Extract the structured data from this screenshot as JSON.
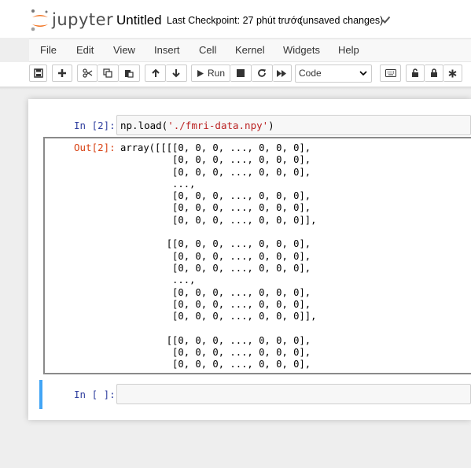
{
  "header": {
    "logo_text": "jupyter",
    "notebook_title": "Untitled",
    "checkpoint": "Last Checkpoint: 27 phút trước",
    "save_status": "(unsaved changes)",
    "saved_icon": "check-icon"
  },
  "menu": {
    "items": [
      "File",
      "Edit",
      "View",
      "Insert",
      "Cell",
      "Kernel",
      "Widgets",
      "Help"
    ]
  },
  "toolbar": {
    "run_label": "Run",
    "cell_type": "Code",
    "icons": [
      "save-icon",
      "plus-icon",
      "cut-icon",
      "copy-icon",
      "paste-icon",
      "arrow-up-icon",
      "arrow-down-icon",
      "play-icon",
      "stop-icon",
      "restart-icon",
      "fast-forward-icon",
      "keyboard-icon",
      "unlock-icon",
      "lock-icon",
      "asterisk-icon"
    ]
  },
  "cells": {
    "cell1": {
      "in_prompt": "In [2]:",
      "code_prefix": "np.load(",
      "code_string": "'./fmri-data.npy'",
      "code_suffix": ")",
      "out_prompt": "Out[2]:",
      "output": "array([[[[0, 0, 0, ..., 0, 0, 0],\n         [0, 0, 0, ..., 0, 0, 0],\n         [0, 0, 0, ..., 0, 0, 0],\n         ...,\n         [0, 0, 0, ..., 0, 0, 0],\n         [0, 0, 0, ..., 0, 0, 0],\n         [0, 0, 0, ..., 0, 0, 0]],\n\n        [[0, 0, 0, ..., 0, 0, 0],\n         [0, 0, 0, ..., 0, 0, 0],\n         [0, 0, 0, ..., 0, 0, 0],\n         ...,\n         [0, 0, 0, ..., 0, 0, 0],\n         [0, 0, 0, ..., 0, 0, 0],\n         [0, 0, 0, ..., 0, 0, 0]],\n\n        [[0, 0, 0, ..., 0, 0, 0],\n         [0, 0, 0, ..., 0, 0, 0],\n         [0, 0, 0, ..., 0, 0, 0],"
    },
    "cell2": {
      "in_prompt": "In [ ]:",
      "code": ""
    }
  },
  "colors": {
    "in_prompt": "#303f9f",
    "out_prompt": "#d84315",
    "selected_cell": "#42a5f5",
    "logo_orange": "#f37726"
  }
}
